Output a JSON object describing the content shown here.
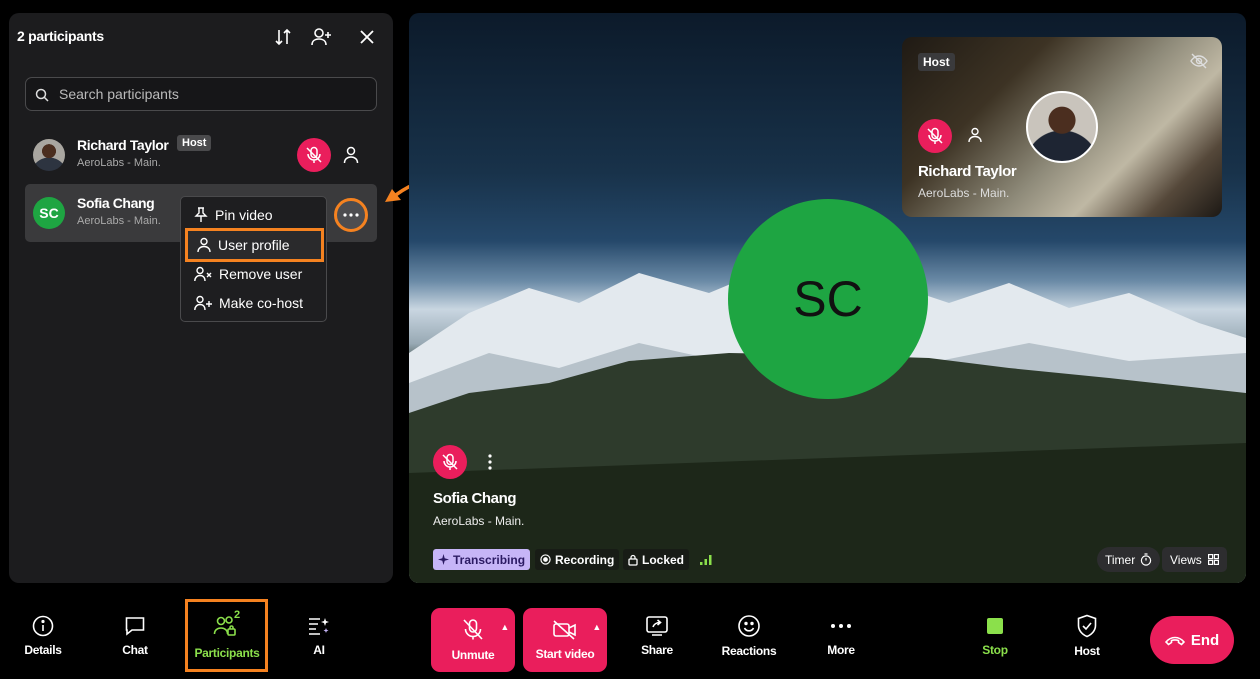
{
  "panel": {
    "title": "2 participants",
    "search_placeholder": "Search participants",
    "participants": [
      {
        "name": "Richard Taylor",
        "org": "AeroLabs - Main.",
        "badge": "Host",
        "muted": true
      },
      {
        "name": "Sofia Chang",
        "org": "AeroLabs - Main.",
        "initials": "SC",
        "muted": true
      }
    ],
    "context_menu": [
      "Pin video",
      "User profile",
      "Remove user",
      "Make co-host"
    ],
    "highlighted_menu_item": "User profile"
  },
  "stage": {
    "main": {
      "initials": "SC",
      "name": "Sofia Chang",
      "org": "AeroLabs - Main."
    },
    "thumbnail": {
      "badge": "Host",
      "name": "Richard Taylor",
      "org": "AeroLabs - Main."
    },
    "status": {
      "transcribing": "Transcribing",
      "recording": "Recording",
      "locked": "Locked"
    },
    "timer_label": "Timer",
    "views_label": "Views"
  },
  "toolbar": {
    "details": "Details",
    "chat": "Chat",
    "participants": "Participants",
    "participants_count": "2",
    "ai": "AI",
    "unmute": "Unmute",
    "start_video": "Start video",
    "share": "Share",
    "reactions": "Reactions",
    "more": "More",
    "stop": "Stop",
    "host": "Host",
    "end": "End"
  },
  "colors": {
    "accent_red": "#ea1e5c",
    "avatar_green": "#1ea542",
    "highlight_orange": "#f58220",
    "stop_green": "#8be04b"
  }
}
